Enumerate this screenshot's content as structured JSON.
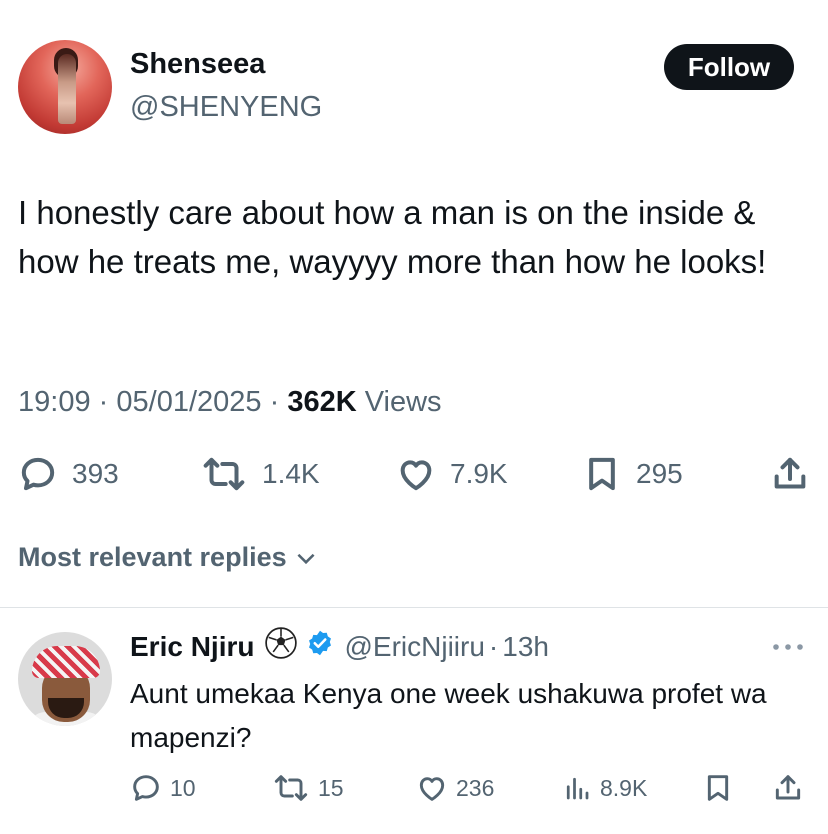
{
  "tweet": {
    "author_name": "Shenseea",
    "author_handle": "@SHENYENG",
    "follow_label": "Follow",
    "text": "I honestly care about how a man is on the inside & how he treats me, wayyyy more than how he looks!",
    "time": "19:09",
    "date": "05/01/2025",
    "separator": "·",
    "views_count": "362K",
    "views_label": "Views",
    "stats": {
      "replies": "393",
      "reposts": "1.4K",
      "likes": "7.9K",
      "bookmarks": "295"
    }
  },
  "replies_section": {
    "header": "Most relevant replies"
  },
  "reply": {
    "name": "Eric Njiru",
    "emoji": "⚽",
    "handle": "@EricNjiiru",
    "separator": "·",
    "time": "13h",
    "text": "Aunt umekaa Kenya one week ushakuwa profet wa mapenzi?",
    "stats": {
      "replies": "10",
      "reposts": "15",
      "likes": "236",
      "views": "8.9K"
    }
  },
  "icons": {
    "verified_color": "#1d9bf0",
    "accent_text": "#0f1419",
    "muted_text": "#536471"
  }
}
